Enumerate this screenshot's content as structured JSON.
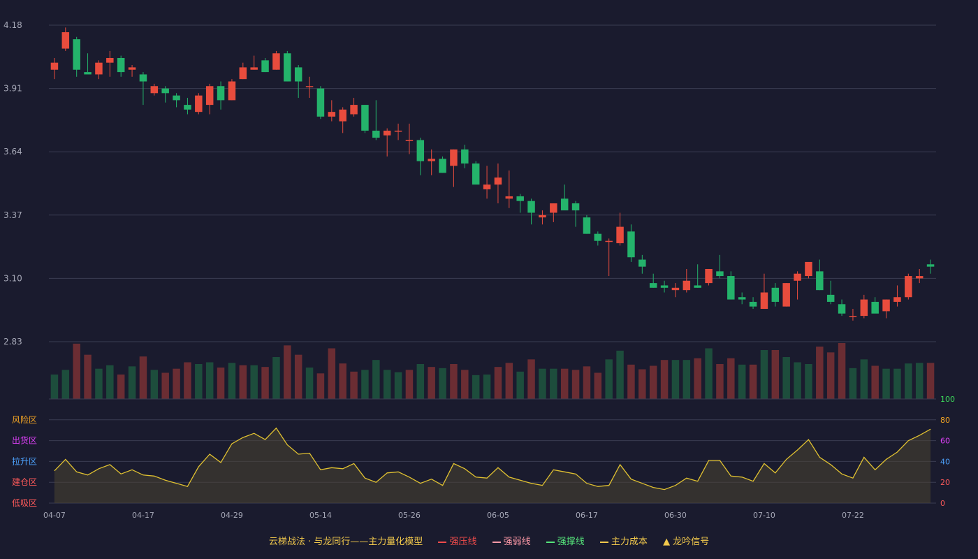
{
  "colors": {
    "up": "#e84c3d",
    "down": "#24b36b",
    "vol_up": "#6b2d33",
    "vol_down": "#1d4d3c",
    "grid": "#3a3c52",
    "axis_text": "#a7a9b8",
    "osc_line": "#e0c131",
    "zone_risk": "#f5a623",
    "zone_ship": "#e040fb",
    "zone_pull": "#4da3ff",
    "zone_build": "#ff5a5a",
    "zone_low": "#ff5a5a",
    "osc_tick_100": "#3ddc5c",
    "osc_tick_80": "#f5a623",
    "osc_tick_60": "#e040fb",
    "osc_tick_40": "#4da3ff",
    "osc_tick_20": "#ff5a5a",
    "osc_tick_0": "#ff5a5a"
  },
  "chart_data": [
    {
      "type": "candlestick",
      "title": "",
      "xlabel": "",
      "ylabel": "",
      "ylim": [
        2.83,
        4.18
      ],
      "y_ticks": [
        "4.18",
        "3.91",
        "3.64",
        "3.37",
        "3.10",
        "2.83"
      ],
      "x_ticks": [
        "04-07",
        "04-17",
        "04-29",
        "05-14",
        "05-26",
        "06-05",
        "06-17",
        "06-30",
        "07-10",
        "07-22"
      ],
      "x_tick_index": [
        0,
        8,
        16,
        24,
        32,
        40,
        48,
        56,
        64,
        72
      ],
      "grid": true,
      "ohlc": [
        [
          3.99,
          4.04,
          3.95,
          4.02
        ],
        [
          4.08,
          4.17,
          4.07,
          4.15
        ],
        [
          4.12,
          4.13,
          3.96,
          3.99
        ],
        [
          3.98,
          4.06,
          3.98,
          3.97
        ],
        [
          3.97,
          4.03,
          3.95,
          4.02
        ],
        [
          4.02,
          4.07,
          3.96,
          4.04
        ],
        [
          4.04,
          4.05,
          3.96,
          3.98
        ],
        [
          3.99,
          4.01,
          3.96,
          4.0
        ],
        [
          3.97,
          3.98,
          3.84,
          3.94
        ],
        [
          3.89,
          3.93,
          3.88,
          3.92
        ],
        [
          3.91,
          3.92,
          3.85,
          3.89
        ],
        [
          3.88,
          3.89,
          3.83,
          3.86
        ],
        [
          3.84,
          3.87,
          3.8,
          3.82
        ],
        [
          3.81,
          3.89,
          3.8,
          3.88
        ],
        [
          3.84,
          3.93,
          3.8,
          3.92
        ],
        [
          3.92,
          3.94,
          3.82,
          3.86
        ],
        [
          3.86,
          3.95,
          3.86,
          3.94
        ],
        [
          3.95,
          4.02,
          3.95,
          4.0
        ],
        [
          3.99,
          4.05,
          3.99,
          4.0
        ],
        [
          4.03,
          4.04,
          3.98,
          3.98
        ],
        [
          3.99,
          4.07,
          3.99,
          4.06
        ],
        [
          4.06,
          4.07,
          3.94,
          3.94
        ],
        [
          4.0,
          4.01,
          3.87,
          3.94
        ],
        [
          3.92,
          3.96,
          3.87,
          3.92
        ],
        [
          3.91,
          3.92,
          3.78,
          3.79
        ],
        [
          3.79,
          3.86,
          3.77,
          3.81
        ],
        [
          3.77,
          3.83,
          3.72,
          3.82
        ],
        [
          3.8,
          3.87,
          3.79,
          3.84
        ],
        [
          3.84,
          3.84,
          3.72,
          3.73
        ],
        [
          3.73,
          3.86,
          3.69,
          3.7
        ],
        [
          3.71,
          3.74,
          3.62,
          3.73
        ],
        [
          3.73,
          3.76,
          3.69,
          3.73
        ],
        [
          3.69,
          3.76,
          3.63,
          3.69
        ],
        [
          3.69,
          3.7,
          3.54,
          3.6
        ],
        [
          3.6,
          3.65,
          3.54,
          3.61
        ],
        [
          3.61,
          3.62,
          3.55,
          3.55
        ],
        [
          3.58,
          3.65,
          3.49,
          3.65
        ],
        [
          3.65,
          3.67,
          3.57,
          3.59
        ],
        [
          3.59,
          3.6,
          3.51,
          3.5
        ],
        [
          3.48,
          3.58,
          3.44,
          3.5
        ],
        [
          3.5,
          3.59,
          3.42,
          3.53
        ],
        [
          3.44,
          3.56,
          3.4,
          3.45
        ],
        [
          3.45,
          3.46,
          3.38,
          3.43
        ],
        [
          3.43,
          3.44,
          3.33,
          3.38
        ],
        [
          3.36,
          3.39,
          3.33,
          3.37
        ],
        [
          3.38,
          3.42,
          3.34,
          3.42
        ],
        [
          3.44,
          3.5,
          3.4,
          3.39
        ],
        [
          3.42,
          3.43,
          3.32,
          3.39
        ],
        [
          3.36,
          3.37,
          3.29,
          3.29
        ],
        [
          3.29,
          3.3,
          3.24,
          3.26
        ],
        [
          3.26,
          3.27,
          3.11,
          3.26
        ],
        [
          3.25,
          3.38,
          3.24,
          3.32
        ],
        [
          3.3,
          3.33,
          3.17,
          3.19
        ],
        [
          3.18,
          3.2,
          3.12,
          3.15
        ],
        [
          3.08,
          3.12,
          3.06,
          3.06
        ],
        [
          3.07,
          3.09,
          3.04,
          3.06
        ],
        [
          3.05,
          3.08,
          3.02,
          3.06
        ],
        [
          3.05,
          3.14,
          3.04,
          3.09
        ],
        [
          3.07,
          3.16,
          3.06,
          3.06
        ],
        [
          3.08,
          3.14,
          3.07,
          3.14
        ],
        [
          3.13,
          3.2,
          3.1,
          3.11
        ],
        [
          3.11,
          3.13,
          3.01,
          3.01
        ],
        [
          3.02,
          3.04,
          2.99,
          3.01
        ],
        [
          3.0,
          3.02,
          2.97,
          2.98
        ],
        [
          2.97,
          3.12,
          2.97,
          3.04
        ],
        [
          3.06,
          3.08,
          2.98,
          3.0
        ],
        [
          2.98,
          3.08,
          2.98,
          3.08
        ],
        [
          3.09,
          3.13,
          3.01,
          3.12
        ],
        [
          3.11,
          3.16,
          3.1,
          3.17
        ],
        [
          3.13,
          3.18,
          3.05,
          3.05
        ],
        [
          3.03,
          3.09,
          2.99,
          3.0
        ],
        [
          2.99,
          3.01,
          2.94,
          2.95
        ],
        [
          2.94,
          2.97,
          2.92,
          2.94
        ],
        [
          2.94,
          3.03,
          2.93,
          3.01
        ],
        [
          3.0,
          3.02,
          2.97,
          2.95
        ],
        [
          2.96,
          3.01,
          2.93,
          3.01
        ],
        [
          3.0,
          3.07,
          2.98,
          3.02
        ],
        [
          3.02,
          3.12,
          3.01,
          3.11
        ],
        [
          3.1,
          3.14,
          3.08,
          3.11
        ],
        [
          3.16,
          3.18,
          3.12,
          3.15
        ]
      ],
      "volume": [
        42,
        50,
        95,
        76,
        52,
        58,
        42,
        56,
        73,
        50,
        45,
        52,
        63,
        60,
        63,
        54,
        62,
        58,
        58,
        55,
        72,
        92,
        76,
        54,
        44,
        87,
        61,
        47,
        50,
        67,
        50,
        46,
        50,
        60,
        55,
        53,
        60,
        50,
        41,
        42,
        55,
        62,
        47,
        68,
        52,
        52,
        52,
        50,
        56,
        45,
        68,
        83,
        59,
        51,
        57,
        67,
        67,
        67,
        70,
        87,
        60,
        70,
        59,
        59,
        84,
        84,
        72,
        63,
        60,
        90,
        80,
        96,
        53,
        68,
        57,
        52,
        52,
        61,
        62,
        62
      ],
      "volume_color": [
        "down",
        "down",
        "up",
        "up",
        "down",
        "down",
        "up",
        "down",
        "up",
        "down",
        "up",
        "up",
        "up",
        "down",
        "down",
        "up",
        "down",
        "up",
        "down",
        "up",
        "down",
        "up",
        "up",
        "down",
        "up",
        "up",
        "up",
        "up",
        "down",
        "down",
        "down",
        "down",
        "up",
        "down",
        "up",
        "down",
        "up",
        "up",
        "down",
        "down",
        "up",
        "up",
        "down",
        "up",
        "down",
        "down",
        "up",
        "up",
        "up",
        "up",
        "down",
        "down",
        "up",
        "up",
        "up",
        "up",
        "down",
        "down",
        "up",
        "down",
        "up",
        "up",
        "down",
        "up",
        "down",
        "up",
        "down",
        "down",
        "down",
        "up",
        "up",
        "up",
        "down",
        "down",
        "up",
        "down",
        "down",
        "down",
        "down",
        "up"
      ]
    },
    {
      "type": "area",
      "title": "",
      "ylim": [
        0,
        100
      ],
      "y_ticks": [
        "100",
        "80",
        "60",
        "40",
        "20",
        "0"
      ],
      "zones": [
        "风险区",
        "出货区",
        "拉升区",
        "建仓区",
        "低吸区"
      ],
      "values": [
        31,
        42,
        30,
        27,
        33,
        37,
        28,
        32,
        27,
        26,
        22,
        19,
        16,
        35,
        47,
        39,
        57,
        63,
        67,
        61,
        72,
        56,
        47,
        48,
        32,
        34,
        33,
        38,
        24,
        20,
        29,
        30,
        25,
        19,
        23,
        17,
        38,
        33,
        25,
        24,
        34,
        25,
        22,
        19,
        17,
        32,
        30,
        28,
        19,
        16,
        17,
        37,
        23,
        19,
        15,
        13,
        17,
        24,
        21,
        41,
        41,
        26,
        25,
        21,
        38,
        29,
        42,
        51,
        61,
        44,
        37,
        28,
        24,
        44,
        32,
        42,
        49,
        60,
        65,
        71
      ],
      "grid": true
    }
  ],
  "legend": {
    "title": "云梯战法 · 与龙同行——主力量化模型",
    "items": [
      {
        "label": "强压线",
        "color": "#ef4b4b",
        "style": "solid"
      },
      {
        "label": "强弱线",
        "color": "#ff9aa8",
        "style": "dashed"
      },
      {
        "label": "强撑线",
        "color": "#55e37a",
        "style": "solid"
      },
      {
        "label": "主力成本",
        "color": "#f2c94c",
        "style": "dashed"
      },
      {
        "label": "龙吟信号",
        "color": "#f2c94c",
        "style": "triangle"
      }
    ]
  }
}
